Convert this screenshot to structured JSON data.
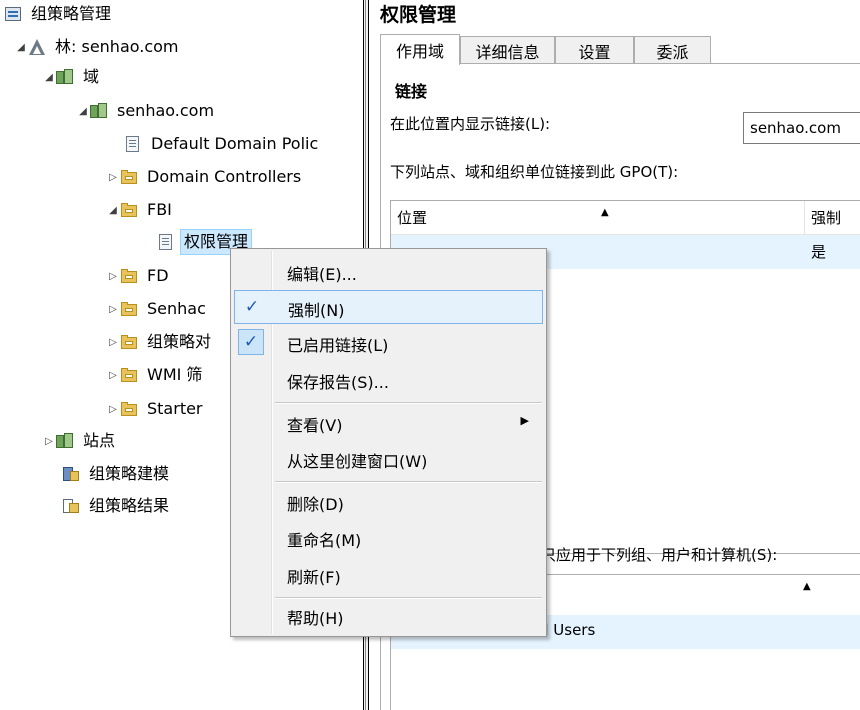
{
  "tree": {
    "root": "组策略管理",
    "forest": "林: senhao.com",
    "domains": "域",
    "domain": "senhao.com",
    "items": [
      "Default Domain Polic",
      "Domain Controllers",
      "FBI",
      "权限管理",
      "FD",
      "Senhac",
      "组策略对",
      "WMI 筛",
      "Starter"
    ],
    "sites": "站点",
    "modeling": "组策略建模",
    "results": "组策略结果"
  },
  "panel": {
    "title": "权限管理",
    "tabs": [
      "作用域",
      "详细信息",
      "设置",
      "委派"
    ],
    "active_tab": "作用域",
    "links_heading": "链接",
    "location_label": "在此位置内显示链接(L):",
    "location_value": "senhao.com",
    "links_caption": "下列站点、域和组织单位链接到此 GPO(T):",
    "links_table": {
      "columns": [
        "位置",
        "强制"
      ],
      "rows": [
        [
          "",
          "是"
        ]
      ]
    },
    "filter_caption": "只应用于下列组、用户和计算机(S):",
    "filter_row": "d Users"
  },
  "context_menu": {
    "items": [
      {
        "label": "编辑(E)...",
        "checked": false
      },
      {
        "label": "强制(N)",
        "checked": true,
        "highlighted": true
      },
      {
        "label": "已启用链接(L)",
        "checked": true
      },
      {
        "label": "保存报告(S)...",
        "checked": false
      },
      {
        "label": "查看(V)",
        "submenu": true
      },
      {
        "label": "从这里创建窗口(W)"
      },
      {
        "label": "删除(D)"
      },
      {
        "label": "重命名(M)"
      },
      {
        "label": "刷新(F)"
      },
      {
        "label": "帮助(H)"
      }
    ],
    "check_glyph": "✓",
    "submenu_glyph": "▶"
  },
  "colors": {
    "selection": "#cce8ff",
    "menu_highlight": "#e5f1fb",
    "check": "#1e5bb3"
  }
}
